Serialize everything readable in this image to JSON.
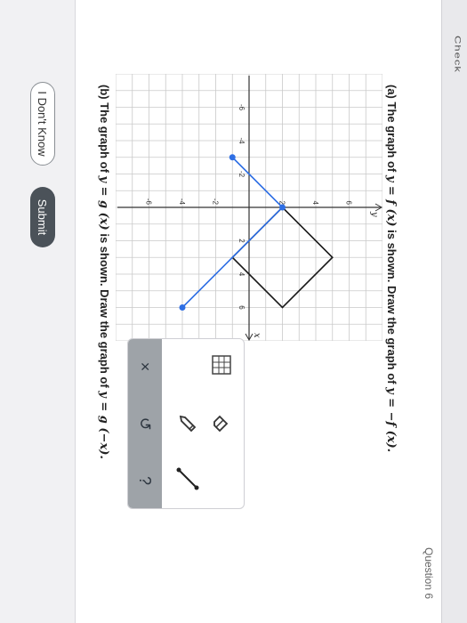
{
  "header": {
    "check_label": "Check"
  },
  "question_label": "Question 6",
  "part_a": {
    "prefix": "(a) The graph of ",
    "func": "y = f (x)",
    "middle": " is shown. Draw the graph of ",
    "target": "y = −f (x)."
  },
  "part_b": {
    "prefix": "(b) The graph of ",
    "func": "y = g (x)",
    "middle": " is shown. Draw the graph of ",
    "target": "y = g (−x)."
  },
  "graph": {
    "x_label": "x",
    "y_label": "y",
    "x_ticks": [
      "-6",
      "-4",
      "-2",
      "2",
      "4",
      "6"
    ],
    "y_ticks": [
      "6",
      "4",
      "2",
      "-2",
      "-4",
      "-6"
    ],
    "f_points": [
      [
        0,
        2
      ],
      [
        3,
        5
      ],
      [
        6,
        2
      ],
      [
        3,
        -1
      ],
      [
        0,
        2
      ]
    ],
    "g_points": [
      [
        -3,
        -1
      ],
      [
        0,
        2
      ],
      [
        3,
        -1
      ],
      [
        6,
        -4
      ]
    ],
    "g_endpoints": [
      [
        0,
        2
      ],
      [
        -3,
        -1
      ],
      [
        6,
        -4
      ]
    ],
    "f_color": "#1a1a1a",
    "g_color": "#2f6fe4"
  },
  "tools": {
    "eraser": "eraser-icon",
    "pencil": "pencil-icon",
    "line": "line-segment-icon",
    "grid": "grid-toggle-icon",
    "clear": "×",
    "undo": "↺",
    "help": "?"
  },
  "buttons": {
    "dont_know": "I Don't Know",
    "submit": "Submit"
  }
}
